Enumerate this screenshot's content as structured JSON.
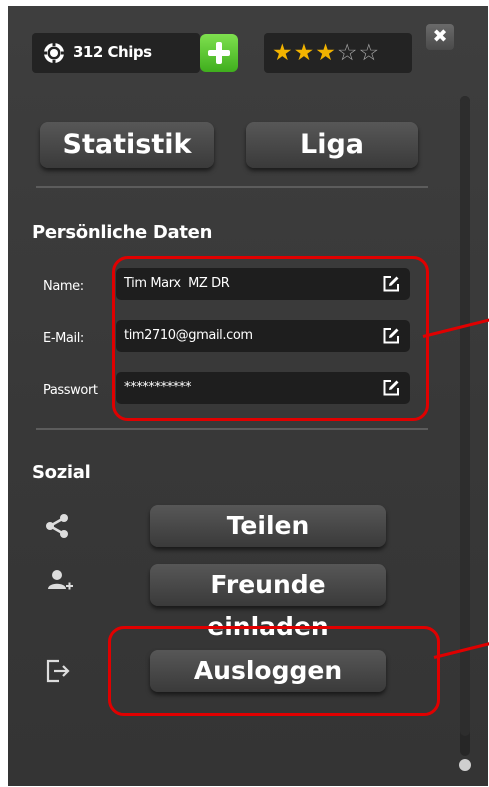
{
  "header": {
    "chips_label": "312 Chips",
    "add_chips_icon": "plus-icon",
    "rating": {
      "filled": 3,
      "total": 5
    },
    "close_icon": "close-icon",
    "close_glyph": "✖"
  },
  "nav": {
    "statistik_label": "Statistik",
    "liga_label": "Liga"
  },
  "personal": {
    "title": "Persönliche Daten",
    "name_label": "Name:",
    "name_value": "Tim Marx  MZ DR",
    "email_label": "E-Mail:",
    "email_value": "tim2710@gmail.com",
    "password_label": "Passwort",
    "password_value": "***********"
  },
  "social": {
    "title": "Sozial",
    "share_label": "Teilen",
    "invite_label": "Freunde einladen",
    "logout_label": "Ausloggen"
  },
  "colors": {
    "panel_bg": "#3b3b3b",
    "accent_green": "#4fc027",
    "star_gold": "#f2b300",
    "annotation_red": "#e00000"
  }
}
